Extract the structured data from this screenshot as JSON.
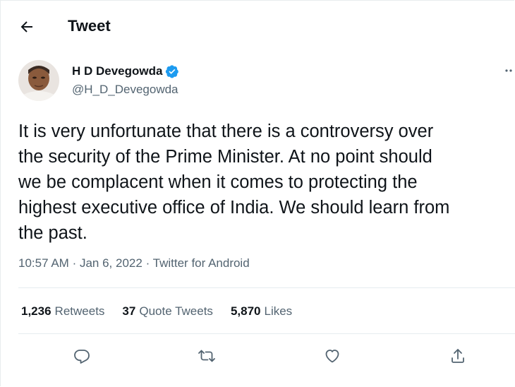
{
  "header": {
    "title": "Tweet",
    "back_icon": "arrow-left-icon"
  },
  "author": {
    "display_name": "H D Devegowda",
    "handle": "@H_D_Devegowda",
    "verified_icon": "verified-badge-icon",
    "avatar": "avatar"
  },
  "tweet": {
    "text": "It is very unfortunate that there is a controversy over\nthe security of the Prime Minister. At no point should\nwe be complacent when it comes to protecting the\nhighest executive office of India. We should learn from\nthe past.",
    "time": "10:57 AM",
    "separator": "·",
    "date": "Jan 6, 2022",
    "source": "Twitter for Android"
  },
  "stats": [
    {
      "count": "1,236",
      "label": "Retweets"
    },
    {
      "count": "37",
      "label": "Quote Tweets"
    },
    {
      "count": "5,870",
      "label": "Likes"
    }
  ],
  "actions": [
    "reply-icon",
    "retweet-icon",
    "like-icon",
    "share-icon"
  ],
  "colors": {
    "text": "#0f1419",
    "secondary": "#536471",
    "verified": "#1d9bf0",
    "divider": "#e6ecf0"
  }
}
